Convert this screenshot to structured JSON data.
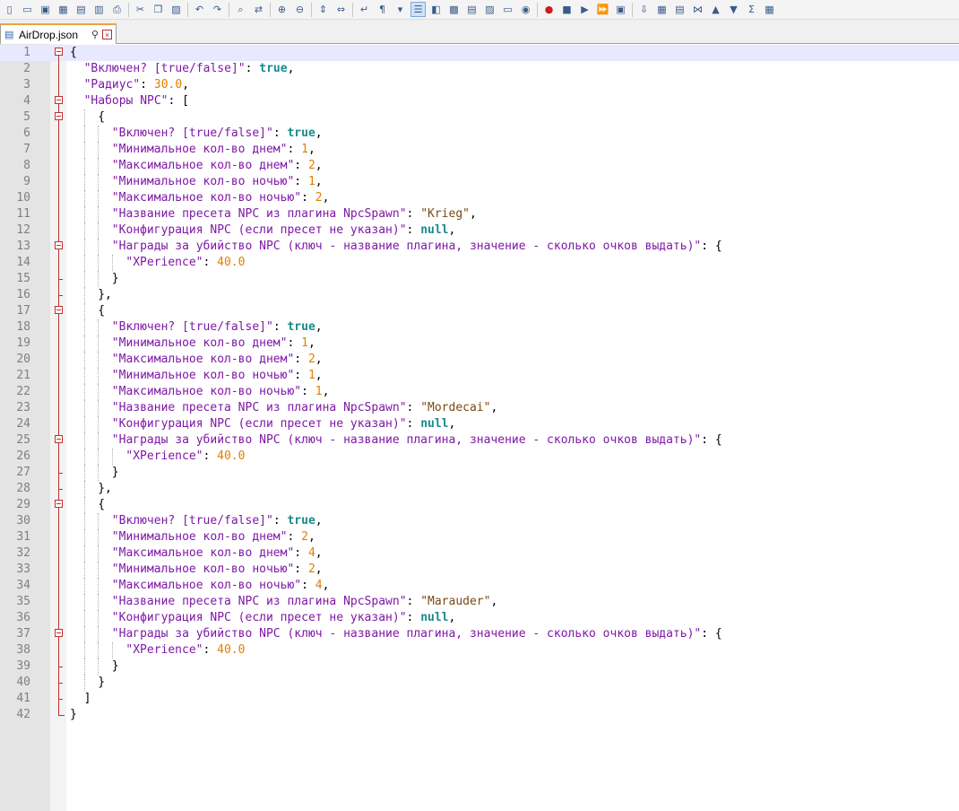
{
  "toolbar": {
    "icons": [
      "new-file-icon",
      "open-file-icon",
      "save-icon",
      "save-all-icon",
      "close-icon",
      "close-all-icon",
      "print-icon",
      "cut-icon",
      "copy-icon",
      "paste-icon",
      "undo-icon",
      "redo-icon",
      "find-icon",
      "replace-icon",
      "zoom-in-icon",
      "zoom-out-icon",
      "sync-vertical-icon",
      "sync-horizontal-icon",
      "word-wrap-icon",
      "show-all-chars-icon",
      "dropdown-icon",
      "indent-guide-icon",
      "user-language-icon",
      "document-map-icon",
      "function-list-icon",
      "folder-workspace-icon",
      "clipboard-icon",
      "monitor-icon",
      "record-macro-icon",
      "stop-macro-icon",
      "play-macro-icon",
      "run-macro-multiple-icon",
      "save-macro-icon",
      "plugin1-icon",
      "plugin2-icon",
      "plugin3-icon",
      "plugin4-icon",
      "up-icon",
      "down-icon",
      "plugin5-icon",
      "plugin6-icon"
    ]
  },
  "tab": {
    "label": "AirDrop.json"
  },
  "lines": [
    [
      [
        "b",
        "{"
      ]
    ],
    [
      [
        "k",
        "\"Включен? [true/false]\""
      ],
      [
        "p",
        ": "
      ],
      [
        "bool",
        "true"
      ],
      [
        "p",
        ","
      ]
    ],
    [
      [
        "k",
        "\"Радиус\""
      ],
      [
        "p",
        ": "
      ],
      [
        "n",
        "30.0"
      ],
      [
        "p",
        ","
      ]
    ],
    [
      [
        "k",
        "\"Наборы NPC\""
      ],
      [
        "p",
        ": ["
      ]
    ],
    [
      [
        "p",
        "{"
      ]
    ],
    [
      [
        "k",
        "\"Включен? [true/false]\""
      ],
      [
        "p",
        ": "
      ],
      [
        "bool",
        "true"
      ],
      [
        "p",
        ","
      ]
    ],
    [
      [
        "k",
        "\"Минимальное кол-во днем\""
      ],
      [
        "p",
        ": "
      ],
      [
        "n",
        "1"
      ],
      [
        "p",
        ","
      ]
    ],
    [
      [
        "k",
        "\"Максимальное кол-во днем\""
      ],
      [
        "p",
        ": "
      ],
      [
        "n",
        "2"
      ],
      [
        "p",
        ","
      ]
    ],
    [
      [
        "k",
        "\"Минимальное кол-во ночью\""
      ],
      [
        "p",
        ": "
      ],
      [
        "n",
        "1"
      ],
      [
        "p",
        ","
      ]
    ],
    [
      [
        "k",
        "\"Максимальное кол-во ночью\""
      ],
      [
        "p",
        ": "
      ],
      [
        "n",
        "2"
      ],
      [
        "p",
        ","
      ]
    ],
    [
      [
        "k",
        "\"Название пресета NPC из плагина NpcSpawn\""
      ],
      [
        "p",
        ": "
      ],
      [
        "s",
        "\"Krieg\""
      ],
      [
        "p",
        ","
      ]
    ],
    [
      [
        "k",
        "\"Конфигурация NPC (если пресет не указан)\""
      ],
      [
        "p",
        ": "
      ],
      [
        "null",
        "null"
      ],
      [
        "p",
        ","
      ]
    ],
    [
      [
        "k",
        "\"Награды за убийство NPC (ключ - название плагина, значение - сколько очков выдать)\""
      ],
      [
        "p",
        ": {"
      ]
    ],
    [
      [
        "k",
        "\"XPerience\""
      ],
      [
        "p",
        ": "
      ],
      [
        "n",
        "40.0"
      ]
    ],
    [
      [
        "p",
        "}"
      ]
    ],
    [
      [
        "p",
        "},"
      ]
    ],
    [
      [
        "p",
        "{"
      ]
    ],
    [
      [
        "k",
        "\"Включен? [true/false]\""
      ],
      [
        "p",
        ": "
      ],
      [
        "bool",
        "true"
      ],
      [
        "p",
        ","
      ]
    ],
    [
      [
        "k",
        "\"Минимальное кол-во днем\""
      ],
      [
        "p",
        ": "
      ],
      [
        "n",
        "1"
      ],
      [
        "p",
        ","
      ]
    ],
    [
      [
        "k",
        "\"Максимальное кол-во днем\""
      ],
      [
        "p",
        ": "
      ],
      [
        "n",
        "2"
      ],
      [
        "p",
        ","
      ]
    ],
    [
      [
        "k",
        "\"Минимальное кол-во ночью\""
      ],
      [
        "p",
        ": "
      ],
      [
        "n",
        "1"
      ],
      [
        "p",
        ","
      ]
    ],
    [
      [
        "k",
        "\"Максимальное кол-во ночью\""
      ],
      [
        "p",
        ": "
      ],
      [
        "n",
        "1"
      ],
      [
        "p",
        ","
      ]
    ],
    [
      [
        "k",
        "\"Название пресета NPC из плагина NpcSpawn\""
      ],
      [
        "p",
        ": "
      ],
      [
        "s",
        "\"Mordecai\""
      ],
      [
        "p",
        ","
      ]
    ],
    [
      [
        "k",
        "\"Конфигурация NPC (если пресет не указан)\""
      ],
      [
        "p",
        ": "
      ],
      [
        "null",
        "null"
      ],
      [
        "p",
        ","
      ]
    ],
    [
      [
        "k",
        "\"Награды за убийство NPC (ключ - название плагина, значение - сколько очков выдать)\""
      ],
      [
        "p",
        ": {"
      ]
    ],
    [
      [
        "k",
        "\"XPerience\""
      ],
      [
        "p",
        ": "
      ],
      [
        "n",
        "40.0"
      ]
    ],
    [
      [
        "p",
        "}"
      ]
    ],
    [
      [
        "p",
        "},"
      ]
    ],
    [
      [
        "p",
        "{"
      ]
    ],
    [
      [
        "k",
        "\"Включен? [true/false]\""
      ],
      [
        "p",
        ": "
      ],
      [
        "bool",
        "true"
      ],
      [
        "p",
        ","
      ]
    ],
    [
      [
        "k",
        "\"Минимальное кол-во днем\""
      ],
      [
        "p",
        ": "
      ],
      [
        "n",
        "2"
      ],
      [
        "p",
        ","
      ]
    ],
    [
      [
        "k",
        "\"Максимальное кол-во днем\""
      ],
      [
        "p",
        ": "
      ],
      [
        "n",
        "4"
      ],
      [
        "p",
        ","
      ]
    ],
    [
      [
        "k",
        "\"Минимальное кол-во ночью\""
      ],
      [
        "p",
        ": "
      ],
      [
        "n",
        "2"
      ],
      [
        "p",
        ","
      ]
    ],
    [
      [
        "k",
        "\"Максимальное кол-во ночью\""
      ],
      [
        "p",
        ": "
      ],
      [
        "n",
        "4"
      ],
      [
        "p",
        ","
      ]
    ],
    [
      [
        "k",
        "\"Название пресета NPC из плагина NpcSpawn\""
      ],
      [
        "p",
        ": "
      ],
      [
        "s",
        "\"Marauder\""
      ],
      [
        "p",
        ","
      ]
    ],
    [
      [
        "k",
        "\"Конфигурация NPC (если пресет не указан)\""
      ],
      [
        "p",
        ": "
      ],
      [
        "null",
        "null"
      ],
      [
        "p",
        ","
      ]
    ],
    [
      [
        "k",
        "\"Награды за убийство NPC (ключ - название плагина, значение - сколько очков выдать)\""
      ],
      [
        "p",
        ": {"
      ]
    ],
    [
      [
        "k",
        "\"XPerience\""
      ],
      [
        "p",
        ": "
      ],
      [
        "n",
        "40.0"
      ]
    ],
    [
      [
        "p",
        "}"
      ]
    ],
    [
      [
        "p",
        "}"
      ]
    ],
    [
      [
        "p",
        "]"
      ]
    ],
    [
      [
        "b",
        "}"
      ]
    ]
  ]
}
